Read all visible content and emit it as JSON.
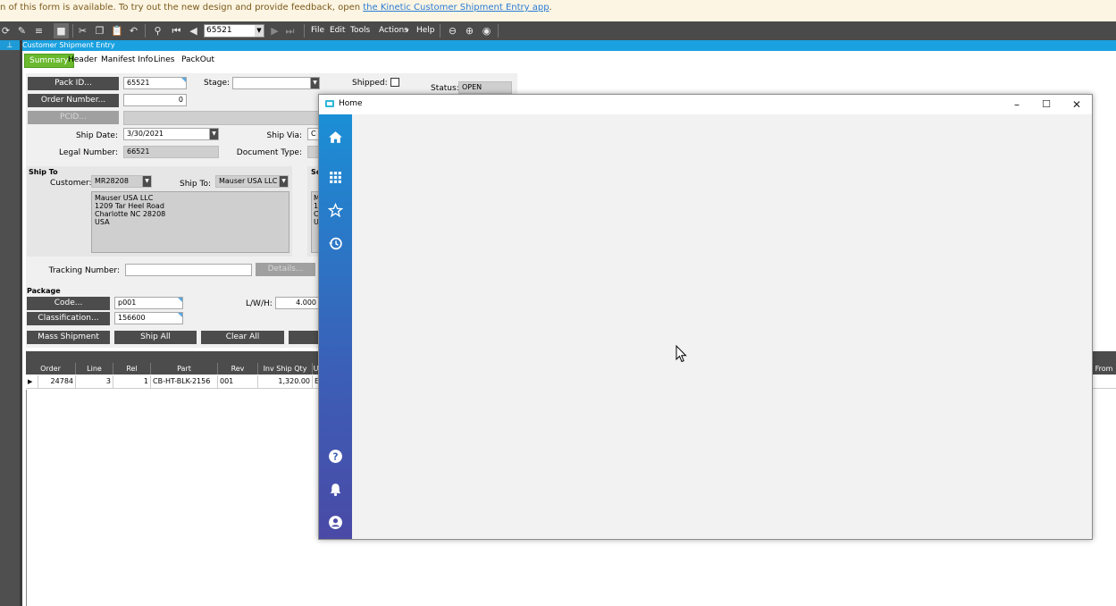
{
  "notice": {
    "text": "n of this form is available. To try out the new design and provide feedback, open ",
    "link": "the Kinetic Customer Shipment Entry app",
    "suffix": "."
  },
  "toolbar": {
    "record_value": "65521",
    "menus": [
      "File",
      "Edit",
      "Tools",
      "Actions",
      "Help"
    ]
  },
  "window_title": "Customer Shipment Entry",
  "tabs": [
    "Summary",
    "Header",
    "Manifest Info",
    "Lines",
    "PackOut"
  ],
  "form": {
    "pack_id_button": "Pack ID...",
    "pack_id_value": "65521",
    "order_number_button": "Order Number...",
    "order_number_value": "0",
    "pcid_button": "PCID...",
    "stage_label": "Stage:",
    "stage_value": "",
    "shipped_label": "Shipped:",
    "status_label": "Status:",
    "status_value": "OPEN",
    "ship_date_label": "Ship Date:",
    "ship_date_value": "3/30/2021",
    "ship_via_label": "Ship Via:",
    "ship_via_value": "C",
    "legal_number_label": "Legal Number:",
    "legal_number_value": "66521",
    "document_type_label": "Document Type:",
    "ship_to_section": "Ship To",
    "customer_label": "Customer:",
    "customer_value": "MR28208",
    "ship_to_label": "Ship To:",
    "ship_to_value": "Mauser USA LLC",
    "address_lines": [
      "Mauser USA LLC",
      "1209 Tar Heel Road",
      "Charlotte NC 28208",
      "USA"
    ],
    "sold_section_partial": "So",
    "sold_address_partial": [
      "M",
      "1",
      "C",
      "U"
    ],
    "tracking_label": "Tracking Number:",
    "tracking_value": "",
    "details_button": "Details...",
    "package_section": "Package",
    "code_button": "Code...",
    "code_value": "p001",
    "classification_button": "Classification...",
    "classification_value": "156600",
    "lwh_label": "L/W/H:",
    "lwh_value": "4.000",
    "mass_shipment_button": "Mass Shipment",
    "ship_all_button": "Ship All",
    "clear_all_button": "Clear All"
  },
  "grid": {
    "columns": [
      "Order",
      "Line",
      "Rel",
      "Part",
      "Rev",
      "Inv Ship Qty",
      "U"
    ],
    "right_column": "From",
    "rows": [
      {
        "order": "24784",
        "line": "3",
        "rel": "1",
        "part": "CB-HT-BLK-2156",
        "rev": "001",
        "qty": "1,320.00",
        "u": "E"
      }
    ]
  },
  "home": {
    "title": "Home",
    "nav_icons": [
      "home-icon",
      "apps-grid-icon",
      "star-icon",
      "history-icon",
      "help-icon",
      "bell-icon",
      "user-icon"
    ]
  },
  "colors": {
    "accent_blue": "#1aa1e0",
    "tab_green": "#6ab92e",
    "dark_button": "#4c4c4c"
  }
}
